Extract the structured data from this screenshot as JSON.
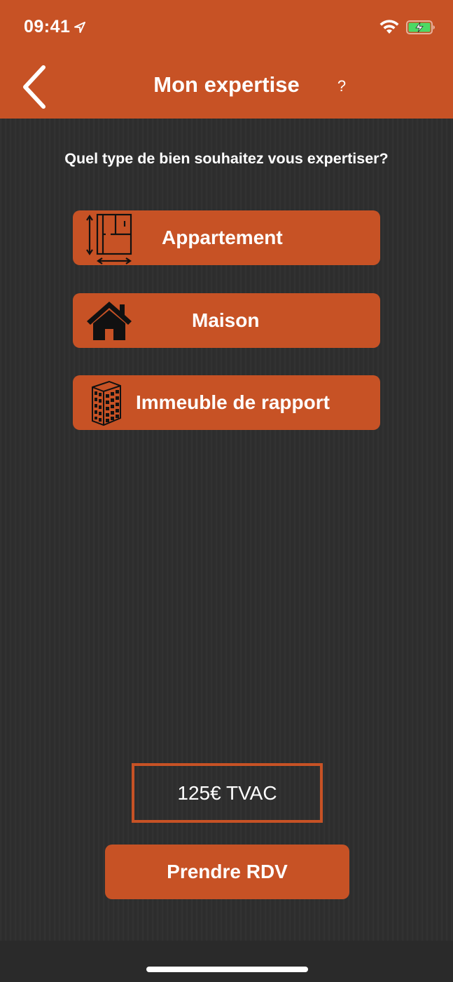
{
  "status_bar": {
    "time": "09:41",
    "icons": [
      "location-arrow-icon",
      "wifi-icon",
      "battery-charging-icon"
    ]
  },
  "header": {
    "title": "Mon expertise",
    "help_label": "?",
    "back_icon": "chevron-left-icon",
    "color": "#c75225"
  },
  "main": {
    "question": "Quel type de bien souhaitez vous expertiser?",
    "options": [
      {
        "label": "Appartement",
        "icon": "floor-plan-icon"
      },
      {
        "label": "Maison",
        "icon": "house-icon"
      },
      {
        "label": "Immeuble de rapport",
        "icon": "building-icon"
      }
    ]
  },
  "price": {
    "text": "125€ TVAC"
  },
  "actions": {
    "rdv_label": "Prendre RDV"
  },
  "colors": {
    "accent": "#c75225",
    "background": "#2e2e2e",
    "text": "#ffffff"
  }
}
